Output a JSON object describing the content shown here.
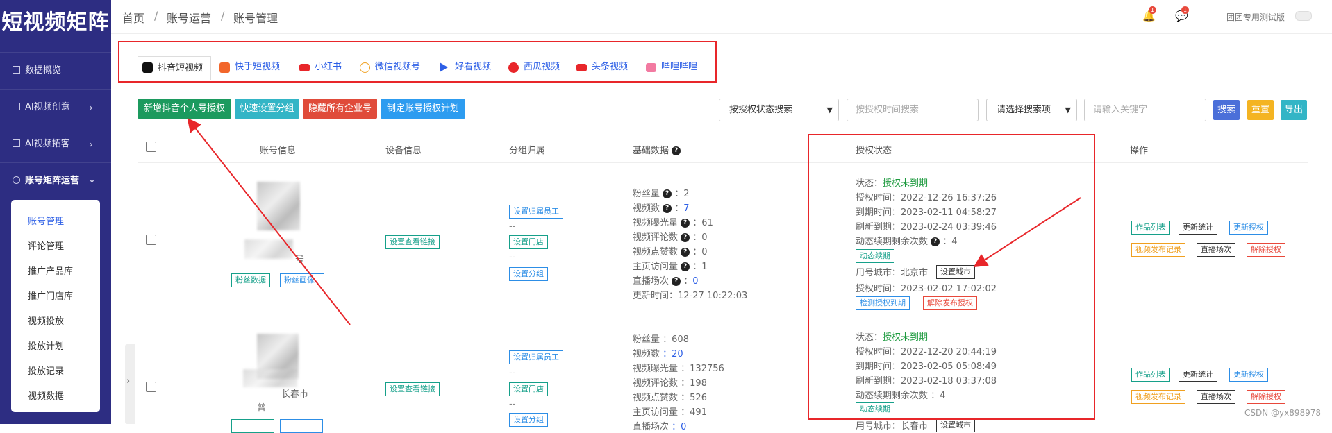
{
  "app": {
    "logo": "短视频矩阵"
  },
  "sidebar": {
    "items": [
      {
        "label": "数据概览",
        "icon": "chart-icon"
      },
      {
        "label": "AI视频创意",
        "icon": "grid-icon"
      },
      {
        "label": "AI视频拓客",
        "icon": "grid-icon"
      },
      {
        "label": "账号矩阵运营",
        "icon": "settings-icon"
      }
    ],
    "submenu": [
      "账号管理",
      "评论管理",
      "推广产品库",
      "推广门店库",
      "视频投放",
      "投放计划",
      "投放记录",
      "视频数据"
    ]
  },
  "breadcrumb": [
    "首页",
    "账号运营",
    "账号管理"
  ],
  "header": {
    "bell_badge": "1",
    "msg_badge": "1",
    "user": "团团专用测试版"
  },
  "platform_tabs": [
    "抖音短视频",
    "快手短视频",
    "小红书",
    "微信视频号",
    "好看视频",
    "西瓜视频",
    "头条视频",
    "哔哩哔哩"
  ],
  "toolbar": {
    "buttons": [
      "新增抖音个人号授权",
      "快速设置分组",
      "隐藏所有企业号",
      "制定账号授权计划"
    ],
    "status_select": "按授权状态搜索",
    "time_placeholder": "按授权时间搜索",
    "item_select": "请选择搜索项",
    "keyword_placeholder": "请输入关键字",
    "search": "搜索",
    "reset": "重置",
    "export": "导出"
  },
  "table": {
    "headers": [
      "账号信息",
      "设备信息",
      "分组归属",
      "基础数据",
      "授权状态",
      "操作"
    ],
    "rows": [
      {
        "account_suffix": "号",
        "account_tags": [
          "粉丝数据",
          "粉丝画像"
        ],
        "device_link": "设置查看链接",
        "group": [
          "设置归属员工",
          "--",
          "设置门店",
          "--",
          "设置分组"
        ],
        "stats": [
          {
            "label": "粉丝量",
            "value": "2"
          },
          {
            "label": "视频数",
            "value": "7"
          },
          {
            "label": "视频曝光量",
            "value": "61"
          },
          {
            "label": "视频评论数",
            "value": "0"
          },
          {
            "label": "视频点赞数",
            "value": "0"
          },
          {
            "label": "主页访问量",
            "value": "1"
          },
          {
            "label": "直播场次",
            "value": "0"
          }
        ],
        "updated": "更新时间：12-27 10:22:03",
        "status_label": "状态：",
        "status_value": "授权未到期",
        "auth_time": "授权时间：2022-12-26 16:37:26",
        "expire_time": "到期时间：2023-02-11 04:58:27",
        "refresh_time": "刷新到期：2023-02-24 03:39:46",
        "renew_left": "动态续期剩余次数",
        "renew_value": "：4",
        "renew_btn": "动态续期",
        "city": "用号城市：北京市",
        "city_btn": "设置城市",
        "auth_time2": "授权时间：2023-02-02 17:02:02",
        "check_btn": "检测授权到期",
        "unbind_btn": "解除发布授权",
        "actions": [
          "作品列表",
          "更新统计",
          "更新授权",
          "视频发布记录",
          "直播场次",
          "解除授权"
        ]
      },
      {
        "account_suffix": "长春市",
        "account_prefix": "普",
        "device_link": "设置查看链接",
        "group": [
          "设置归属员工",
          "--",
          "设置门店",
          "--",
          "设置分组"
        ],
        "stats": [
          {
            "label": "粉丝量",
            "value": "：608"
          },
          {
            "label": "视频数",
            "value": "：20"
          },
          {
            "label": "视频曝光量",
            "value": "：132756"
          },
          {
            "label": "视频评论数",
            "value": "：198"
          },
          {
            "label": "视频点赞数",
            "value": "：526"
          },
          {
            "label": "主页访问量",
            "value": "：491"
          },
          {
            "label": "直播场次",
            "value": "：0"
          }
        ],
        "status_label": "状态：",
        "status_value": "授权未到期",
        "auth_time": "授权时间：2022-12-20 20:44:19",
        "expire_time": "到期时间：2023-02-05 05:08:49",
        "refresh_time": "刷新到期：2023-02-18 03:37:08",
        "renew_left": "动态续期剩余次数",
        "renew_value": "：4",
        "renew_btn": "动态续期",
        "city": "用号城市：长春市",
        "city_btn": "设置城市",
        "actions": [
          "作品列表",
          "更新统计",
          "更新授权",
          "视频发布记录",
          "直播场次",
          "解除授权"
        ]
      }
    ]
  },
  "watermark": "CSDN @yx898978",
  "colors": {
    "sidebar": "#2d2d82",
    "highlight": "#e8262a",
    "green": "#1c9a3e",
    "link": "#2d5fe6"
  }
}
